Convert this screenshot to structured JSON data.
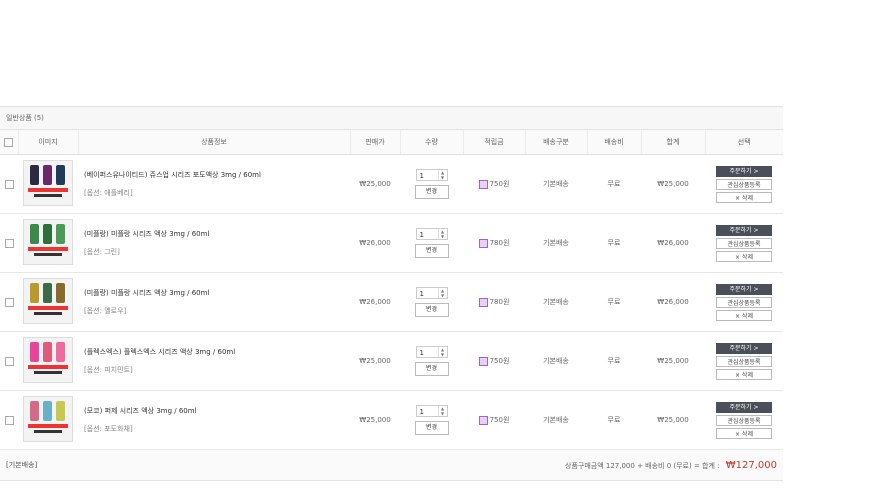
{
  "section": {
    "title": "일반상품 (5)"
  },
  "columns": [
    "이미지",
    "상품정보",
    "판매가",
    "수량",
    "적립금",
    "배송구분",
    "배송비",
    "합계",
    "선택"
  ],
  "buttons": {
    "change": "변경",
    "order": "주문하기 >",
    "wish": "관심상품등록",
    "delete": "× 삭제"
  },
  "items": [
    {
      "name": "(베이퍼스유나이티드) 쥬스업 시리즈 포도액상 3mg / 60ml",
      "option": "[옵션: 애플베리]",
      "price": "₩25,000",
      "qty": "1",
      "reward": "750원",
      "ship_type": "기본배송",
      "ship_fee": "무료",
      "total": "₩25,000"
    },
    {
      "name": "(미플랑) 미플랑 시리즈 액상 3mg / 60ml",
      "option": "[옵션: 그린]",
      "price": "₩26,000",
      "qty": "1",
      "reward": "780원",
      "ship_type": "기본배송",
      "ship_fee": "무료",
      "total": "₩26,000"
    },
    {
      "name": "(미플랑) 미플랑 시리즈 액상 3mg / 60ml",
      "option": "[옵션: 옐로우]",
      "price": "₩26,000",
      "qty": "1",
      "reward": "780원",
      "ship_type": "기본배송",
      "ship_fee": "무료",
      "total": "₩26,000"
    },
    {
      "name": "(플렉스엑스) 플렉스엑스 시리즈 액상 3mg / 60ml",
      "option": "[옵션: 피치민트]",
      "price": "₩25,000",
      "qty": "1",
      "reward": "750원",
      "ship_type": "기본배송",
      "ship_fee": "무료",
      "total": "₩25,000"
    },
    {
      "name": "(모코) 퍼제 시리즈 액상 3mg / 60ml",
      "option": "[옵션: 포도화채]",
      "price": "₩25,000",
      "qty": "1",
      "reward": "750원",
      "ship_type": "기본배송",
      "ship_fee": "무료",
      "total": "₩25,000"
    }
  ],
  "footer": {
    "label": "[기본배송]",
    "summary": "상품구매금액 127,000 + 배송비 0 (무료) = 합계 :",
    "total": "₩127,000"
  },
  "colors": {
    "accent": "#c0392b",
    "order_btn": "#4a4f5a",
    "reward_icon": "#a064c8"
  }
}
